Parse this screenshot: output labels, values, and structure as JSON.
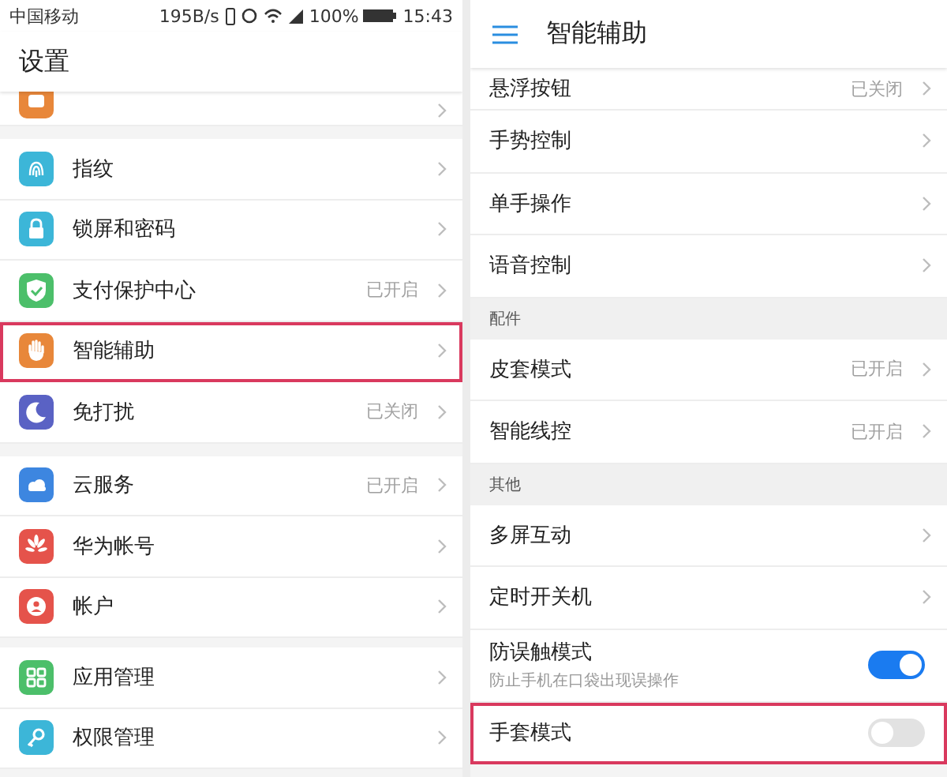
{
  "left": {
    "status_bar": {
      "carrier": "中国移动",
      "speed": "195B/s",
      "battery": "100%",
      "time": "15:43"
    },
    "title": "设置",
    "groups": [
      {
        "items": [
          {
            "kind": "partial",
            "color": "#e8873a",
            "highlighted": false
          }
        ]
      },
      {
        "items": [
          {
            "kind": "link",
            "label": "指纹",
            "color": "#3cb6d8",
            "highlighted": false
          },
          {
            "kind": "link",
            "label": "锁屏和密码",
            "color": "#3cb6d8",
            "highlighted": false
          },
          {
            "kind": "link",
            "label": "支付保护中心",
            "value": "已开启",
            "color": "#4cbf6a",
            "highlighted": false
          },
          {
            "kind": "link",
            "label": "智能辅助",
            "color": "#e8873a",
            "highlighted": true
          },
          {
            "kind": "link",
            "label": "免打扰",
            "value": "已关闭",
            "color": "#5a62c4",
            "highlighted": false
          }
        ]
      },
      {
        "items": [
          {
            "kind": "link",
            "label": "云服务",
            "value": "已开启",
            "color": "#3d86e0",
            "highlighted": false
          },
          {
            "kind": "link",
            "label": "华为帐号",
            "color": "#e5534b",
            "highlighted": false
          },
          {
            "kind": "link",
            "label": "帐户",
            "color": "#e5534b",
            "highlighted": false
          }
        ]
      },
      {
        "items": [
          {
            "kind": "link",
            "label": "应用管理",
            "color": "#4cbf6a",
            "highlighted": false
          },
          {
            "kind": "link",
            "label": "权限管理",
            "color": "#3cb6d8",
            "highlighted": false
          }
        ]
      }
    ]
  },
  "right": {
    "title": "智能辅助",
    "sections": [
      {
        "items": [
          {
            "kind": "link",
            "label": "悬浮按钮",
            "value": "已关闭",
            "highlighted": false
          },
          {
            "kind": "link",
            "label": "手势控制",
            "highlighted": false
          },
          {
            "kind": "link",
            "label": "单手操作",
            "highlighted": false
          },
          {
            "kind": "link",
            "label": "语音控制",
            "highlighted": false
          }
        ]
      },
      {
        "header": "配件",
        "items": [
          {
            "kind": "link",
            "label": "皮套模式",
            "value": "已开启",
            "highlighted": false
          },
          {
            "kind": "link",
            "label": "智能线控",
            "value": "已开启",
            "highlighted": false
          }
        ]
      },
      {
        "header": "其他",
        "items": [
          {
            "kind": "link",
            "label": "多屏互动",
            "highlighted": false
          },
          {
            "kind": "link",
            "label": "定时开关机",
            "highlighted": false
          },
          {
            "kind": "switch",
            "label": "防误触模式",
            "subtitle": "防止手机在口袋出现误操作",
            "on": true,
            "highlighted": false
          },
          {
            "kind": "switch",
            "label": "手套模式",
            "on": false,
            "highlighted": true
          }
        ]
      }
    ]
  }
}
